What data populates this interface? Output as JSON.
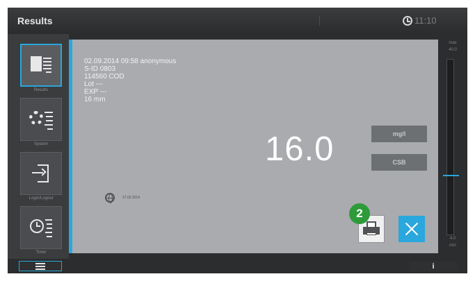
{
  "header": {
    "title": "Results",
    "time": "11:10"
  },
  "sidebar": {
    "items": [
      {
        "label": "Results",
        "active": true,
        "icon": "results-list-icon"
      },
      {
        "label": "System",
        "active": false,
        "icon": "settings-gear-icon"
      },
      {
        "label": "Login/Logout",
        "active": false,
        "icon": "logout-icon"
      },
      {
        "label": "Timer",
        "active": false,
        "icon": "timer-list-icon"
      }
    ]
  },
  "result": {
    "lines": [
      "02.09.2014 09:58 anonymous",
      "S-ID 0803",
      "114560 COD",
      "Lot ---",
      "EXP ---",
      "16 mm"
    ],
    "value": "16.0",
    "unit": "mg/l",
    "parameter": "CSB",
    "date_icon": "globe-icon",
    "date": "27.02.2014"
  },
  "scale": {
    "max_label": "max",
    "max_value": "40.0",
    "min_value": "4.0",
    "min_label": "min",
    "marker_level": 0.34
  },
  "callout": {
    "number": "2"
  },
  "footer": {
    "info_label": "i"
  },
  "colors": {
    "accent": "#2aa7dc",
    "badge": "#2e9b3a",
    "panel": "#a9abae",
    "background": "#2b2d2e"
  }
}
